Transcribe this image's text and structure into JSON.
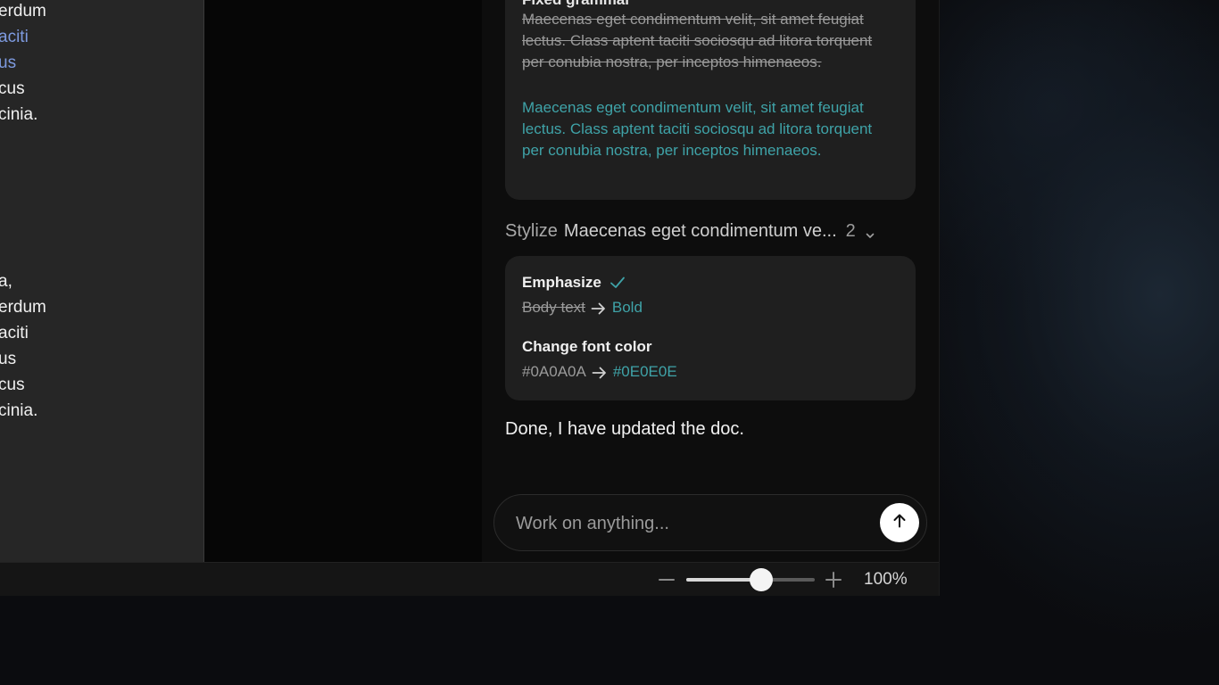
{
  "document": {
    "lines": [
      {
        "text": "erdum",
        "link": false
      },
      {
        "text": "aciti",
        "link": true
      },
      {
        "text": "us",
        "link": true
      },
      {
        "text": "cus",
        "link": false
      },
      {
        "text": "cinia.",
        "link": false
      },
      {
        "text": "a,",
        "link": false
      },
      {
        "text": "erdum",
        "link": false
      },
      {
        "text": "aciti",
        "link": false
      },
      {
        "text": "us",
        "link": false
      },
      {
        "text": "cus",
        "link": false
      },
      {
        "text": "cinia.",
        "link": false
      }
    ]
  },
  "chat": {
    "grammar_card": {
      "heading": "Fixed grammar",
      "old_text": "Maecenas eget condimentum velit, sit amet feugiat lectus. Class aptent taciti sociosqu ad litora torquent per conubia nostra, per inceptos himenaeos.",
      "new_text": "Maecenas eget condimentum velit, sit amet feugiat lectus. Class aptent taciti sociosqu ad litora torquent per conubia nostra, per inceptos himenaeos."
    },
    "stylize": {
      "label": "Stylize",
      "target": "Maecenas eget condimentum ve...",
      "count": "2",
      "changes": [
        {
          "title": "Emphasize",
          "old": "Body text",
          "new": "Bold",
          "confirmed": true
        },
        {
          "title": "Change font color",
          "old": "#0A0A0A",
          "new": "#0E0E0E",
          "confirmed": false
        }
      ]
    },
    "reply": "Done, I have updated the doc.",
    "input": {
      "placeholder": "Work on anything...",
      "value": ""
    }
  },
  "status_bar": {
    "zoom_label": "100%",
    "zoom_fraction": 0.58
  },
  "colors": {
    "accent_teal": "#3fa3a8",
    "link_blue": "#7e9be0",
    "card_bg": "#1f1f1f"
  },
  "icons": [
    "check-icon",
    "arrow-right-icon",
    "chevron-down-icon",
    "arrow-up-icon",
    "minus-icon",
    "plus-icon"
  ]
}
